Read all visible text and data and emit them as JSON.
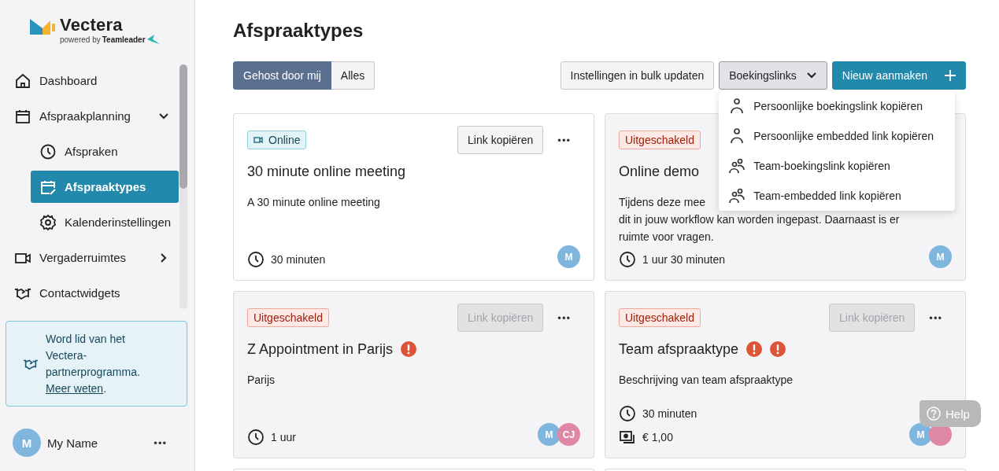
{
  "brand": {
    "name": "Vectera",
    "powered_by": "powered by",
    "partner": "Teamleader"
  },
  "nav": [
    {
      "label": "Dashboard",
      "selected": false
    },
    {
      "label": "Afspraakplanning",
      "selected": false,
      "expanded": true,
      "children": [
        {
          "label": "Afspraken",
          "selected": false
        },
        {
          "label": "Afspraaktypes",
          "selected": true
        },
        {
          "label": "Kalenderinstellingen",
          "selected": false
        }
      ]
    },
    {
      "label": "Vergaderruimtes",
      "selected": false,
      "expanded": false
    },
    {
      "label": "Contactwidgets",
      "selected": false
    }
  ],
  "promo": {
    "text": "Word lid van het Vectera-partnerprogramma.",
    "link": "Meer weten",
    "after": "."
  },
  "user": {
    "initial": "M",
    "name": "My Name",
    "menu": "•••"
  },
  "page": {
    "title": "Afspraaktypes"
  },
  "filters": [
    {
      "label": "Gehost door mij",
      "selected": true
    },
    {
      "label": "Alles",
      "selected": false
    }
  ],
  "actions": [
    {
      "label": "Instellingen in bulk updaten",
      "kind": "plain"
    },
    {
      "label": "Boekingslinks",
      "kind": "dropdown",
      "expanded": true
    },
    {
      "label": "Nieuw aanmaken",
      "kind": "primary"
    }
  ],
  "dropdown": [
    {
      "label": "Persoonlijke boekingslink kopiëren",
      "kind": "person"
    },
    {
      "label": "Persoonlijke embedded link kopiëren",
      "kind": "person"
    },
    {
      "label": "Team-boekingslink kopiëren",
      "kind": "team"
    },
    {
      "label": "Team-embedded link kopiëren",
      "kind": "team"
    }
  ],
  "cards": [
    {
      "badge": {
        "label": "Online",
        "kind": "online"
      },
      "enabled": true,
      "button": "Link kopiëren",
      "more": "•••",
      "title": "30 minute online meeting",
      "description": [
        "A 30 minute online meeting"
      ],
      "meta": [
        {
          "kind": "duration",
          "text": "30 minuten"
        }
      ],
      "avatars": [
        {
          "initials": "M",
          "color": "#7fb6dd"
        }
      ]
    },
    {
      "badge": {
        "label": "Uitgeschakeld",
        "kind": "disabled"
      },
      "enabled": false,
      "title": "Online demo",
      "description": [
        "Tijdens deze mee",
        "dit in jouw workflow kan worden ingepast. Daarnaast is er",
        "ruimte voor vragen."
      ],
      "meta": [
        {
          "kind": "duration",
          "text": "1 uur 30 minuten"
        }
      ],
      "avatars": [
        {
          "initials": "M",
          "color": "#7fb6dd"
        }
      ]
    },
    {
      "badge": {
        "label": "Uitgeschakeld",
        "kind": "disabled"
      },
      "enabled": false,
      "button": "Link kopiëren",
      "more": "•••",
      "title": "Z Appointment in Parijs",
      "alerts": [
        {
          "kind": "error"
        }
      ],
      "description": [
        "Parijs"
      ],
      "meta": [
        {
          "kind": "duration",
          "text": "1 uur"
        }
      ],
      "avatars": [
        {
          "initials": "M",
          "color": "#7fb6dd"
        },
        {
          "initials": "CJ",
          "color": "#df88a6"
        }
      ]
    },
    {
      "badge": {
        "label": "Uitgeschakeld",
        "kind": "disabled"
      },
      "enabled": false,
      "button": "Link kopiëren",
      "more": "•••",
      "title": "Team afspraaktype",
      "alerts": [
        {
          "kind": "error"
        },
        {
          "kind": "error"
        }
      ],
      "description": [
        "Beschrijving van team afspraaktype"
      ],
      "meta": [
        {
          "kind": "duration",
          "text": "30 minuten"
        },
        {
          "kind": "price",
          "text": "€ 1,00"
        }
      ],
      "avatars": [
        {
          "initials": "M",
          "color": "#7fb6dd"
        },
        {
          "color": "#df88a6"
        }
      ]
    }
  ],
  "help": {
    "label": "Help"
  }
}
